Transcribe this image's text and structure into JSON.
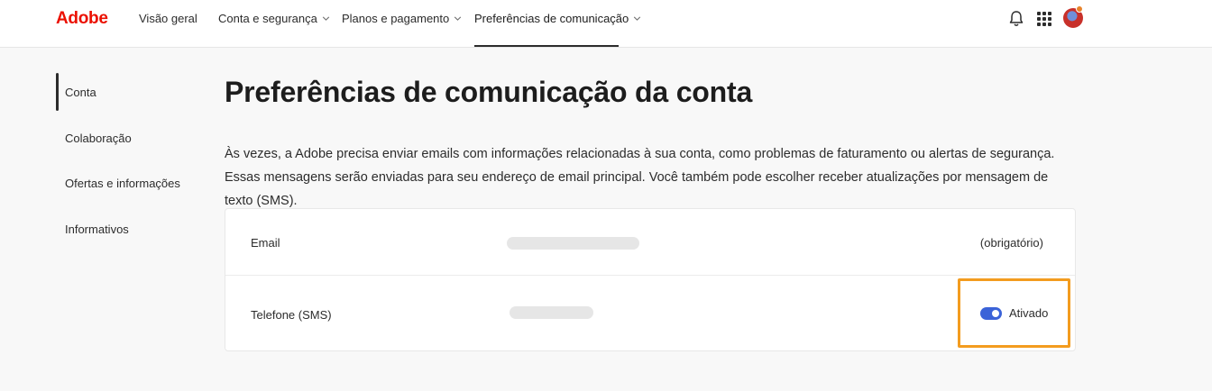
{
  "header": {
    "logo": "Adobe",
    "nav": [
      {
        "label": "Visão geral"
      },
      {
        "label": "Conta e segurança"
      },
      {
        "label": "Planos e pagamento"
      },
      {
        "label": "Preferências de comunicação"
      }
    ],
    "icons": [
      "bell-icon",
      "apps-grid-icon",
      "avatar"
    ],
    "brand_color": "#eb1000"
  },
  "sidebar": {
    "items": [
      {
        "label": "Conta"
      },
      {
        "label": "Colaboração"
      },
      {
        "label": "Ofertas e informações"
      },
      {
        "label": "Informativos"
      }
    ]
  },
  "main": {
    "title": "Preferências de comunicação da conta",
    "intro": "Às vezes, a Adobe precisa enviar emails com informações relacionadas à sua conta, como problemas de faturamento ou alertas de segurança. Essas mensagens serão enviadas para seu endereço de email principal. Você também pode escolher receber atualizações por mensagem de texto (SMS).",
    "rows": [
      {
        "label": "Email",
        "status": "(obrigatório)"
      },
      {
        "label": "Telefone (SMS)",
        "toggle_label": "Ativado",
        "toggle_on": true
      }
    ],
    "toggle_color": "#3b63d8",
    "highlight_color": "#f39c1f"
  }
}
